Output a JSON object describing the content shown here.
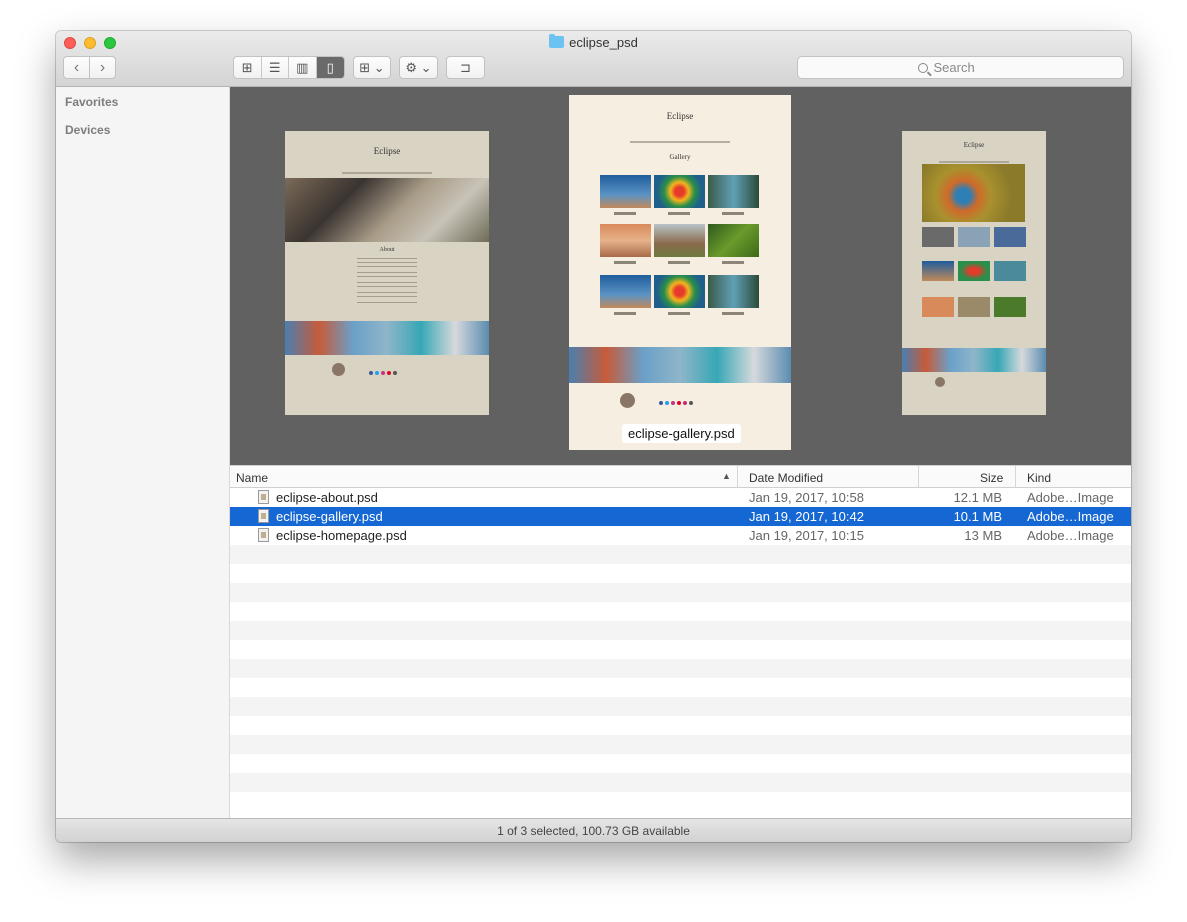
{
  "window": {
    "title": "eclipse_psd"
  },
  "toolbar": {
    "back_glyph": "‹",
    "forward_glyph": "›",
    "views": [
      {
        "name": "icon-view",
        "glyph": "⊞"
      },
      {
        "name": "list-view",
        "glyph": "☰"
      },
      {
        "name": "column-view",
        "glyph": "▥"
      },
      {
        "name": "coverflow-view",
        "glyph": "▯"
      }
    ],
    "arrange_glyph": "⊞ ⌄",
    "action_glyph": "⚙ ⌄",
    "newfolder_glyph": "⊐",
    "search_placeholder": "Search"
  },
  "sidebar": {
    "sections": [
      "Favorites",
      "Devices"
    ]
  },
  "preview": {
    "caption": "eclipse-gallery.psd",
    "thumb_titles": [
      "Eclipse",
      "Eclipse",
      "Eclipse"
    ],
    "gallery_heading": "Gallery",
    "about_heading": "About"
  },
  "list": {
    "columns": {
      "name": "Name",
      "date": "Date Modified",
      "size": "Size",
      "kind": "Kind"
    },
    "files": [
      {
        "name": "eclipse-about.psd",
        "date": "Jan 19, 2017, 10:58",
        "size": "12.1 MB",
        "kind": "Adobe…Image",
        "selected": false
      },
      {
        "name": "eclipse-gallery.psd",
        "date": "Jan 19, 2017, 10:42",
        "size": "10.1 MB",
        "kind": "Adobe…Image",
        "selected": true
      },
      {
        "name": "eclipse-homepage.psd",
        "date": "Jan 19, 2017, 10:15",
        "size": "13 MB",
        "kind": "Adobe…Image",
        "selected": false
      }
    ]
  },
  "status": {
    "text": "1 of 3 selected, 100.73 GB available"
  },
  "colors": {
    "selection": "#1567d3",
    "preview_bg": "#616161"
  }
}
